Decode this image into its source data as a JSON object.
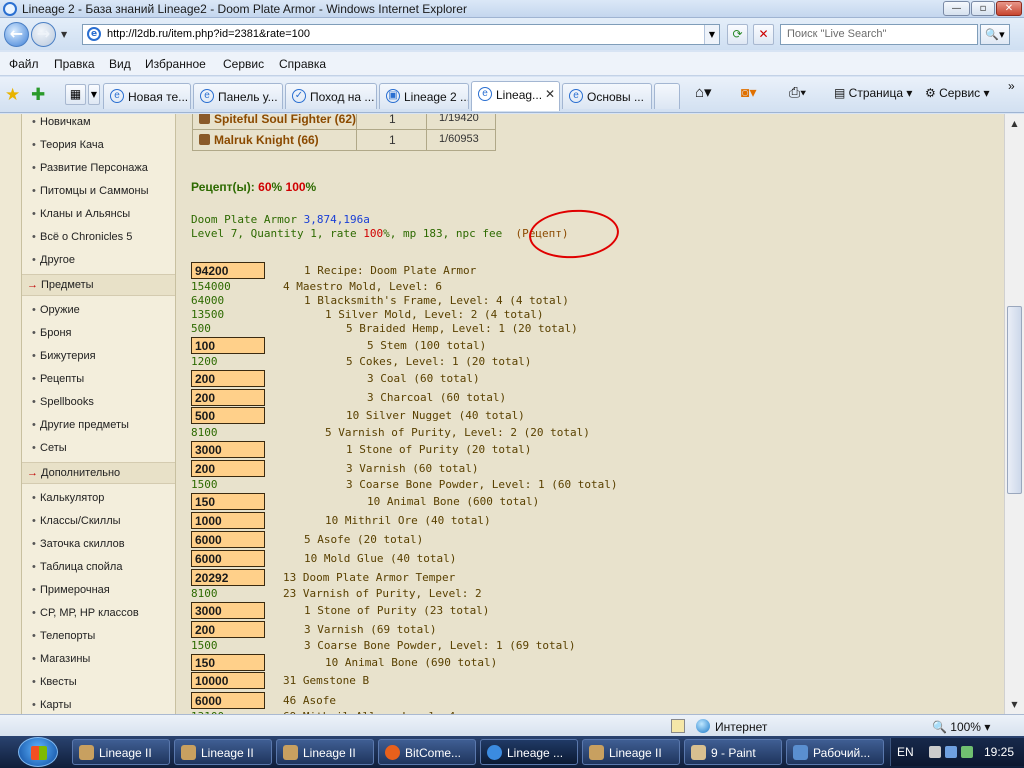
{
  "window": {
    "title": "Lineage 2 - База знаний Lineage2 - Doom Plate Armor - Windows Internet Explorer",
    "minimize": "—",
    "maximize": "▫",
    "close": "✕"
  },
  "address": {
    "url": "http://l2db.ru/item.php?id=2381&rate=100",
    "search_placeholder": "Поиск \"Live Search\""
  },
  "menu": [
    "Файл",
    "Правка",
    "Вид",
    "Избранное",
    "Сервис",
    "Справка"
  ],
  "tabs": [
    {
      "label": "Новая те..."
    },
    {
      "label": "Панель у..."
    },
    {
      "label": "Поход на ..."
    },
    {
      "label": "Lineage 2 ..."
    },
    {
      "label": "Lineag...",
      "active": true
    },
    {
      "label": "Основы ..."
    }
  ],
  "commands": {
    "page": "Страница",
    "tools": "Сервис"
  },
  "sidebar": {
    "items_top": [
      "Новичкам",
      "Теория Кача",
      "Развитие Персонажа",
      "Питомцы и Саммоны",
      "Кланы и Альянсы",
      "Всё о Chronicles 5",
      "Другое"
    ],
    "section_items": "Предметы",
    "items_items": [
      "Оружие",
      "Броня",
      "Бижутерия",
      "Рецепты",
      "Spellbooks",
      "Другие предметы",
      "Сеты"
    ],
    "section_extra": "Дополнительно",
    "items_extra": [
      "Калькулятор",
      "Классы/Скиллы",
      "Заточка скиллов",
      "Таблица спойла",
      "Примерочная",
      "СР, МР, НР классов",
      "Телепорты",
      "Магазины",
      "Квесты",
      "Карты"
    ]
  },
  "drops": [
    {
      "monster": "Spiteful Soul Fighter (62)",
      "count": "1",
      "chance": "1/19420"
    },
    {
      "monster": "Malruk Knight (66)",
      "count": "1",
      "chance": "1/60953"
    }
  ],
  "recipes": {
    "label": "Рецепт(ы):",
    "r60": "60",
    "pct1": "%",
    "r100": "100",
    "pct2": "%"
  },
  "summary": {
    "name": "Doom Plate Armor",
    "price": "3,874,196a",
    "line2a": "Level 7, Quantity 1, rate",
    "rate": "100",
    "line2b": "%, mp 183, npc fee",
    "recipe_link": "(Рецепт)"
  },
  "tree": [
    {
      "input": "94200",
      "indent": 1,
      "text": "1 Recipe: Doom Plate Armor"
    },
    {
      "price": "154000",
      "indent": 0,
      "text": "4 Maestro Mold, Level: 6"
    },
    {
      "price": "64000",
      "indent": 1,
      "text": "1 Blacksmith's Frame, Level: 4 (4 total)"
    },
    {
      "price": "13500",
      "indent": 2,
      "text": "1 Silver Mold, Level: 2 (4 total)"
    },
    {
      "price": "500",
      "indent": 3,
      "text": "5 Braided Hemp, Level: 1 (20 total)"
    },
    {
      "input": "100",
      "indent": 4,
      "text": "5 Stem (100 total)"
    },
    {
      "price": "1200",
      "indent": 3,
      "text": "5 Cokes, Level: 1 (20 total)"
    },
    {
      "input": "200",
      "indent": 4,
      "text": "3 Coal (60 total)"
    },
    {
      "input": "200",
      "indent": 4,
      "text": "3 Charcoal (60 total)"
    },
    {
      "input": "500",
      "indent": 3,
      "text": "10 Silver Nugget (40 total)"
    },
    {
      "price": "8100",
      "indent": 2,
      "text": "5 Varnish of Purity, Level: 2 (20 total)"
    },
    {
      "input": "3000",
      "indent": 3,
      "text": "1 Stone of Purity (20 total)"
    },
    {
      "input": "200",
      "indent": 3,
      "text": "3 Varnish (60 total)"
    },
    {
      "price": "1500",
      "indent": 3,
      "text": "3 Coarse Bone Powder, Level: 1 (60 total)"
    },
    {
      "input": "150",
      "indent": 4,
      "text": "10 Animal Bone (600 total)"
    },
    {
      "input": "1000",
      "indent": 2,
      "text": "10 Mithril Ore (40 total)"
    },
    {
      "input": "6000",
      "indent": 1,
      "text": "5 Asofe (20 total)"
    },
    {
      "input": "6000",
      "indent": 1,
      "text": "10 Mold Glue (40 total)"
    },
    {
      "input": "20292",
      "indent": 0,
      "text": "13 Doom Plate Armor Temper"
    },
    {
      "price": "8100",
      "indent": 0,
      "text": "23 Varnish of Purity, Level: 2"
    },
    {
      "input": "3000",
      "indent": 1,
      "text": "1 Stone of Purity (23 total)"
    },
    {
      "input": "200",
      "indent": 1,
      "text": "3 Varnish (69 total)"
    },
    {
      "price": "1500",
      "indent": 1,
      "text": "3 Coarse Bone Powder, Level: 1 (69 total)"
    },
    {
      "input": "150",
      "indent": 2,
      "text": "10 Animal Bone (690 total)"
    },
    {
      "input": "10000",
      "indent": 0,
      "text": "31 Gemstone B"
    },
    {
      "input": "6000",
      "indent": 0,
      "text": "46 Asofe"
    },
    {
      "price": "13100",
      "indent": 0,
      "text": "69 Mithril Alloy, Level: 4"
    }
  ],
  "status": {
    "zone": "Интернет",
    "zoom": "100%"
  },
  "taskbar": {
    "tasks": [
      "Lineage II",
      "Lineage II",
      "Lineage II",
      "BitCome...",
      "Lineage ...",
      "Lineage II",
      "9 - Paint",
      "Рабочий..."
    ],
    "lang": "EN",
    "clock": "19:25"
  }
}
